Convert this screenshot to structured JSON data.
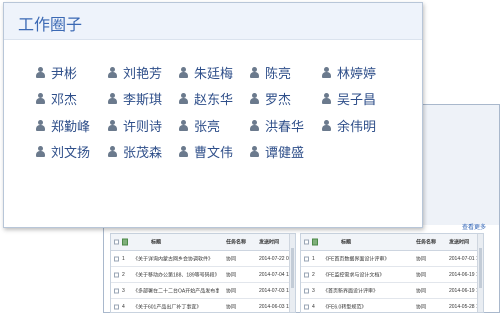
{
  "popup": {
    "title": "工作圈子",
    "members": [
      "尹彬",
      "刘艳芳",
      "朱廷梅",
      "陈亮",
      "林婷婷",
      "邓杰",
      "李斯琪",
      "赵东华",
      "罗杰",
      "吴子昌",
      "郑勤峰",
      "许则诗",
      "张亮",
      "洪春华",
      "余伟明",
      "刘文扬",
      "张茂森",
      "曹文伟",
      "谭健盛"
    ],
    "icon": "person-icon"
  },
  "background": {
    "more_link": "查看更多",
    "left_table": {
      "headers": {
        "title": "标题",
        "name": "任务名称",
        "time": "发送时间"
      },
      "rows": [
        {
          "no": "1",
          "title": "《关于详询内蒙古网乡会协调软件》",
          "name": "协同",
          "time": "2014-07-22 09:"
        },
        {
          "no": "2",
          "title": "《关于移动办公第188、189等号码段》",
          "name": "协同",
          "time": "2014-07-04 11:"
        },
        {
          "no": "3",
          "title": "《多部署在二十二台OA开始产品发布事宜》",
          "name": "协同",
          "time": "2014-07-03 11:"
        },
        {
          "no": "4",
          "title": "《关于601产品出厂补丁事宜》",
          "name": "协同",
          "time": "2014-06-03 11:"
        }
      ]
    },
    "right_table": {
      "headers": {
        "title": "标题",
        "name": "任务名称",
        "time": "发送时间"
      },
      "rows": [
        {
          "no": "1",
          "title": "《FE首页数据界面设计评审》",
          "name": "协同",
          "time": "2014-07-01 11:"
        },
        {
          "no": "2",
          "title": "《FE监控需求与设计文档》",
          "name": "协同",
          "time": "2014-06-19 14:"
        },
        {
          "no": "3",
          "title": "《首页新界面设计评审》",
          "name": "协同",
          "time": "2014-06-19 11:"
        },
        {
          "no": "4",
          "title": "《FE6.0转型规范》",
          "name": "协同",
          "time": "2014-05-28 14:"
        }
      ]
    }
  }
}
